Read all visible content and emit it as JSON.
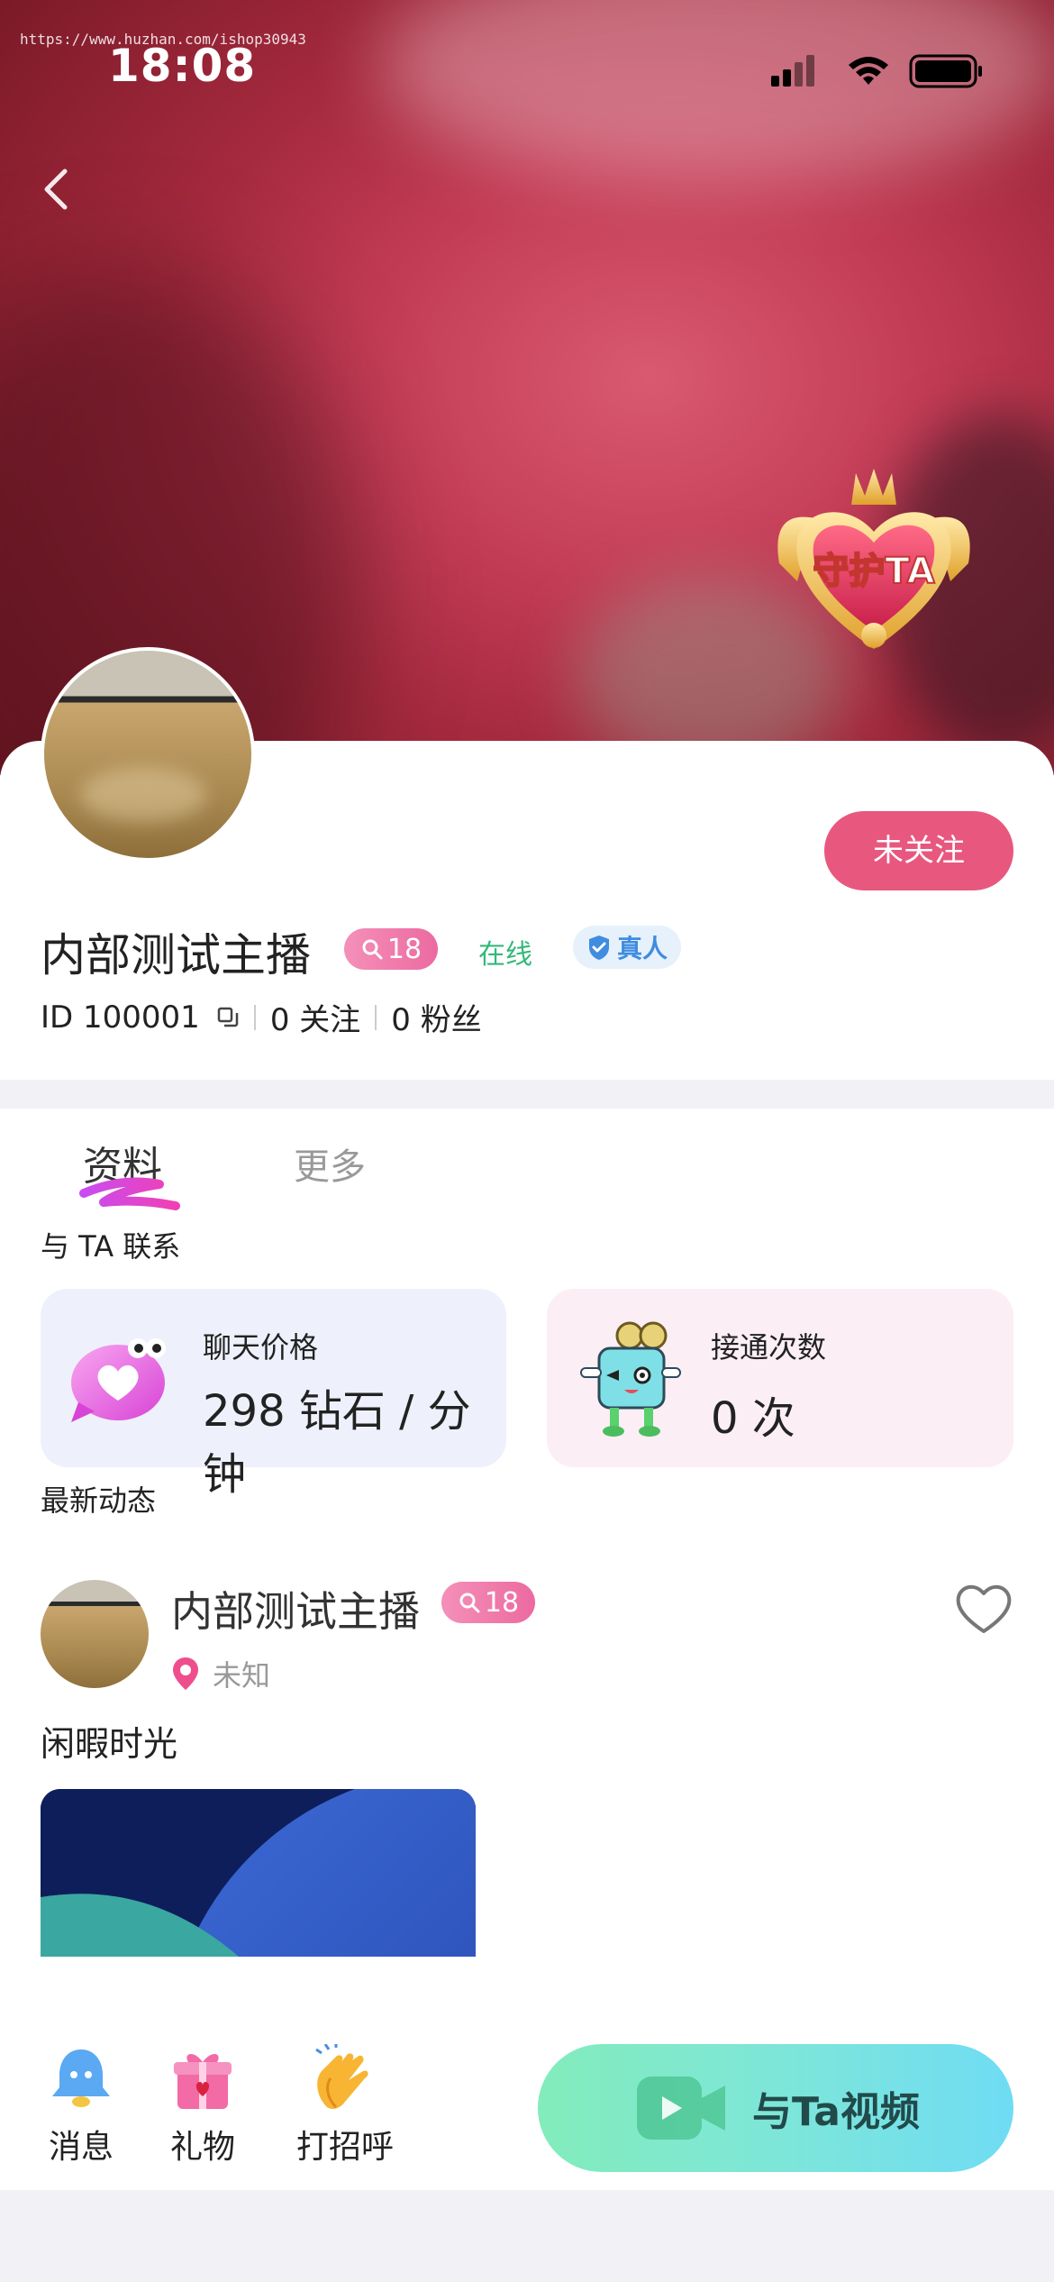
{
  "status": {
    "time": "18:08",
    "watermark": "https://www.huzhan.com/ishop30943"
  },
  "hero": {
    "guard_badge_text": "守护TA"
  },
  "profile": {
    "follow_label": "未关注",
    "name": "内部测试主播",
    "age": "18",
    "online": "在线",
    "real_label": "真人",
    "id_text": "ID 100001",
    "following_text": "0 关注",
    "fans_text": "0 粉丝"
  },
  "tabs": [
    {
      "label": "资料",
      "active": true
    },
    {
      "label": "更多",
      "active": false
    }
  ],
  "contact": {
    "title": "与 TA 联系",
    "chat_price_label": "聊天价格",
    "chat_price_value": "298 钻石 / 分钟",
    "connect_label": "接通次数",
    "connect_value": "0 次"
  },
  "moments": {
    "title": "最新动态",
    "post": {
      "name": "内部测试主播",
      "age": "18",
      "location": "未知",
      "text": "闲暇时光"
    }
  },
  "bottom": {
    "message": "消息",
    "gift": "礼物",
    "greet": "打招呼",
    "video_cta": "与Ta视频"
  },
  "colors": {
    "accent_pink": "#e8577e",
    "online_green": "#35b87a",
    "real_blue": "#3f8ce0"
  }
}
